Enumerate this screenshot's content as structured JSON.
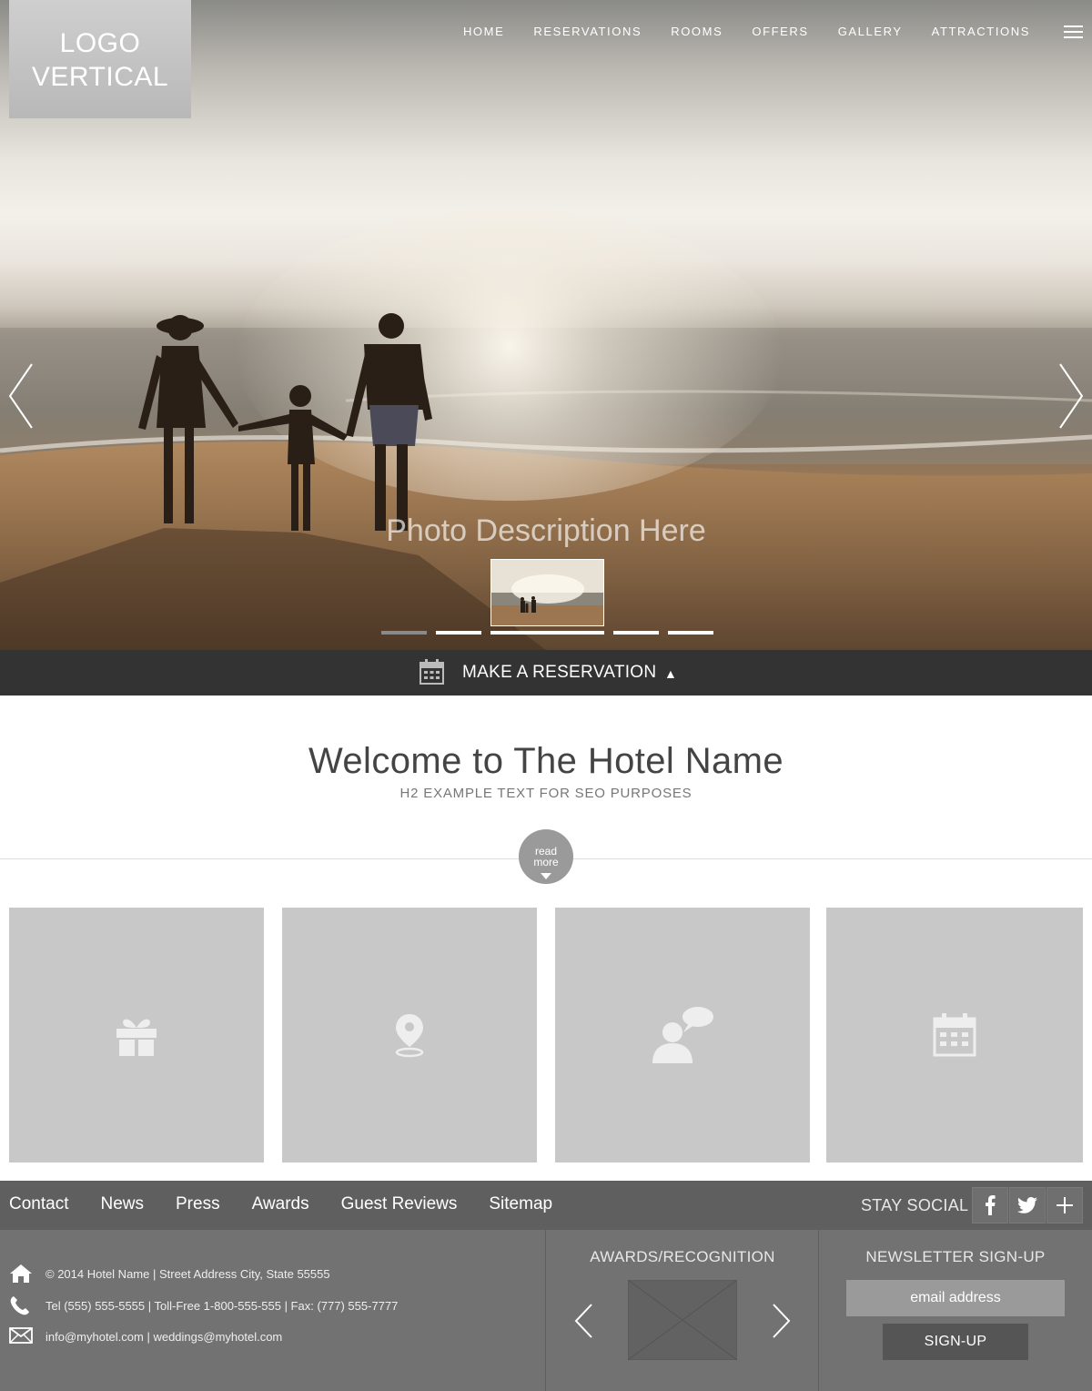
{
  "logo": {
    "line1": "LOGO",
    "line2": "VERTICAL"
  },
  "nav": {
    "items": [
      "HOME",
      "RESERVATIONS",
      "ROOMS",
      "OFFERS",
      "GALLERY",
      "ATTRACTIONS"
    ],
    "menu_icon": "hamburger-icon"
  },
  "hero": {
    "photo_description": "Photo Description Here",
    "prev_icon": "chevron-left-icon",
    "next_icon": "chevron-right-icon",
    "slide_count": 5,
    "active_slide": 1
  },
  "reservation_bar": {
    "label": "MAKE A RESERVATION",
    "icon": "calendar-icon",
    "toggle": "▲"
  },
  "welcome": {
    "title": "Welcome to The Hotel Name",
    "subtitle": "H2 EXAMPLE TEXT FOR SEO PURPOSES",
    "read_more_line1": "read",
    "read_more_line2": "more"
  },
  "tiles": [
    "gift-icon",
    "map-pin-icon",
    "person-chat-icon",
    "calendar-icon"
  ],
  "footer_nav": {
    "links": [
      "Contact",
      "News",
      "Press",
      "Awards",
      "Guest Reviews",
      "Sitemap"
    ],
    "social_label": "STAY SOCIAL",
    "social_icons": [
      "facebook-icon",
      "twitter-icon",
      "plus-icon"
    ]
  },
  "footer": {
    "address": "© 2014 Hotel Name  |  Street Address City, State 55555",
    "phones": "Tel (555) 555-5555  |  Toll-Free 1-800-555-555  |  Fax: (777) 555-7777",
    "emails": "info@myhotel.com  |  weddings@myhotel.com",
    "awards_title": "AWARDS/RECOGNITION",
    "newsletter_title": "NEWSLETTER SIGN-UP",
    "email_placeholder": "email address",
    "signup_label": "SIGN-UP"
  },
  "colors": {
    "reservation_bar": "#333333",
    "footer_nav": "#5f5f5f",
    "footer": "#727272",
    "tile": "#c8c8c8"
  }
}
